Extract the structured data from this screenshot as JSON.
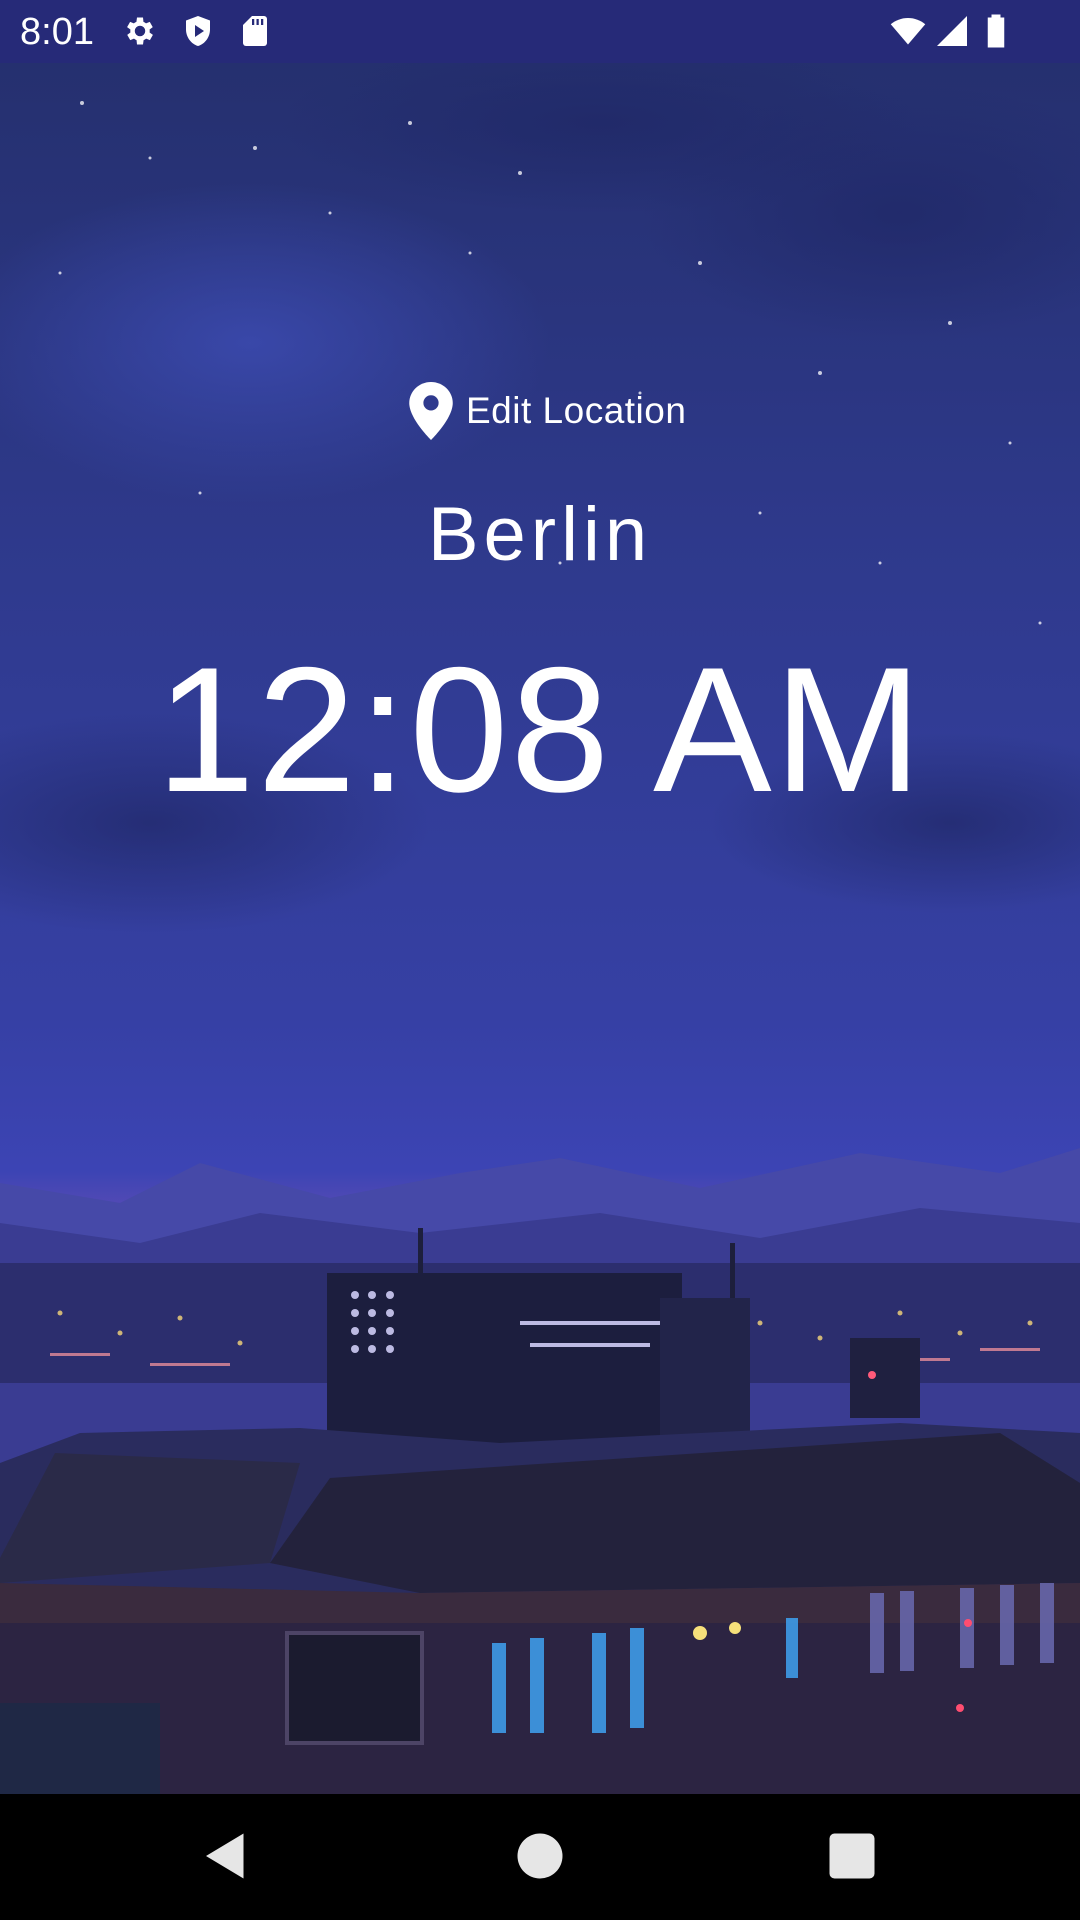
{
  "status_bar": {
    "time": "8:01",
    "background": "#262a78",
    "left_icons": [
      "settings-gear-icon",
      "play-protect-shield-icon",
      "sd-card-icon"
    ],
    "right_icons": [
      "wifi-icon",
      "cellular-signal-icon",
      "battery-icon"
    ]
  },
  "main": {
    "edit_location": {
      "icon": "location-pin-icon",
      "label": "Edit Location"
    },
    "city": "Berlin",
    "time": "12:08 AM"
  },
  "wallpaper": {
    "description_colors": {
      "sky_top": "#2b3580",
      "sky_mid": "#3741a6",
      "horizon_glow": "#c060b8",
      "mountains": "#3c3f9a",
      "buildings": "#1d1f3c"
    }
  },
  "nav_bar": {
    "buttons": [
      "back-icon",
      "home-icon",
      "recents-icon"
    ]
  }
}
